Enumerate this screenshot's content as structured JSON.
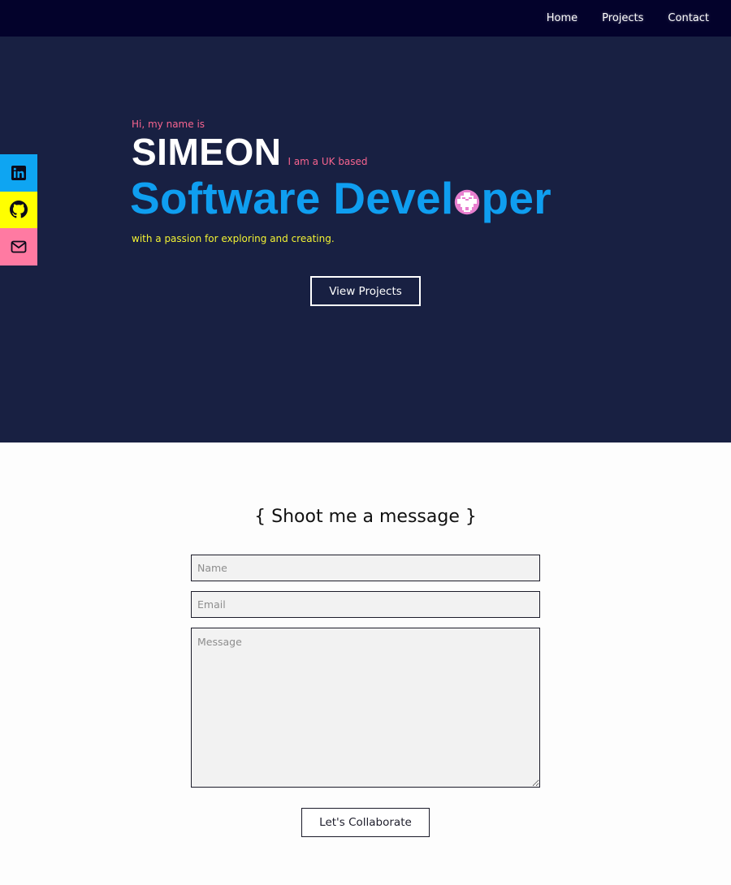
{
  "nav": {
    "items": [
      {
        "label": "Home"
      },
      {
        "label": "Projects"
      },
      {
        "label": "Contact"
      }
    ]
  },
  "social": {
    "items": [
      {
        "icon": "linkedin-icon",
        "color": "#0ea5f2"
      },
      {
        "icon": "github-icon",
        "color": "#ffff00"
      },
      {
        "icon": "mail-icon",
        "color": "#ff7aa2"
      }
    ]
  },
  "hero": {
    "greeting": "Hi, my name is",
    "name": "SIMEON",
    "based": "I am a UK based",
    "title_start": "Software Devel",
    "title_o": "o",
    "title_end": "per",
    "tagline": "with a passion for exploring and creating.",
    "cta_label": "View Projects"
  },
  "contact": {
    "heading": "{ Shoot me a message }",
    "name_placeholder": "Name",
    "email_placeholder": "Email",
    "message_placeholder": "Message",
    "submit_label": "Let's Collaborate"
  },
  "colors": {
    "nav_bg": "#03022b",
    "hero_bg": "#182042",
    "accent_blue": "#0f9ef0",
    "accent_pink": "#f7648f",
    "accent_yellow": "#f2f233"
  }
}
